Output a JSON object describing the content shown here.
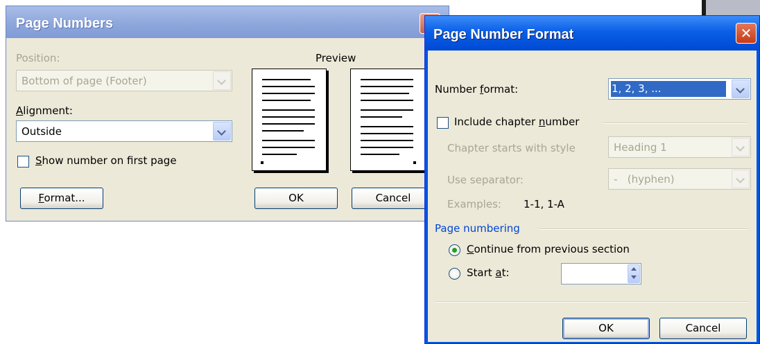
{
  "page_numbers": {
    "title": "Page Numbers",
    "position_label": "Position:",
    "position_value": "Bottom of page (Footer)",
    "alignment_label": "Alignment:",
    "alignment_value": "Outside",
    "show_first_page_label": "Show number on first page",
    "show_first_page_checked": false,
    "format_button": "Format...",
    "preview_label": "Preview",
    "ok_button": "OK",
    "cancel_button": "Cancel"
  },
  "page_number_format": {
    "title": "Page Number Format",
    "number_format_label": "Number format:",
    "number_format_value": "1, 2, 3, ...",
    "include_chapter_label": "Include chapter number",
    "include_chapter_checked": false,
    "chapter_style_label": "Chapter starts with style",
    "chapter_style_value": "Heading 1",
    "separator_label": "Use separator:",
    "separator_value": "-   (hyphen)",
    "examples_label": "Examples:",
    "examples_value": "1-1, 1-A",
    "page_numbering_label": "Page numbering",
    "continue_label": "Continue from previous section",
    "continue_selected": true,
    "start_at_label": "Start at:",
    "start_at_value": "",
    "ok_button": "OK",
    "cancel_button": "Cancel"
  },
  "icons": [
    "close-icon",
    "chevron-down-icon",
    "spinner-arrows-icon"
  ],
  "colors": {
    "title_active": "#0a5fe6",
    "title_inactive": "#8ea8dc",
    "dialog_face": "#ece9d8",
    "selection": "#316ac5"
  }
}
